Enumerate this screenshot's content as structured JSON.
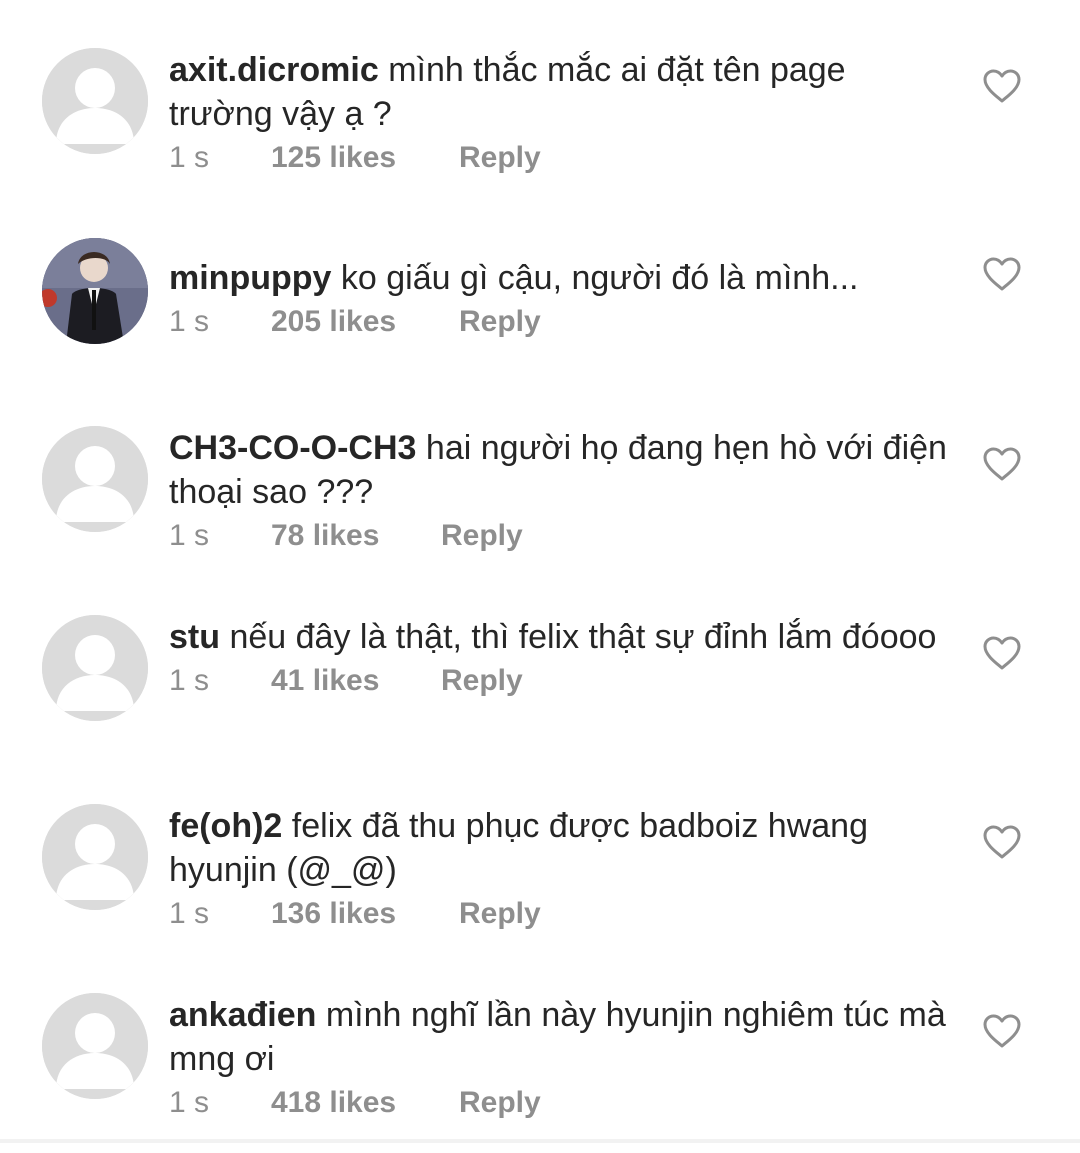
{
  "comments": [
    {
      "username": "axit.dicromic",
      "text": "mình thắc mắc ai đặt tên page trường vậy ạ ?",
      "time": "1 s",
      "likes": "125 likes",
      "reply_label": "Reply",
      "avatar_type": "default-avatar"
    },
    {
      "username": "minpuppy",
      "text": "ko giấu gì cậu, người đó là mình...",
      "time": "1 s",
      "likes": "205 likes",
      "reply_label": "Reply",
      "avatar_type": "photo-avatar"
    },
    {
      "username": "CH3-CO-O-CH3",
      "text": "hai người họ đang hẹn hò với điện thoại sao ???",
      "time": "1 s",
      "likes": "78 likes",
      "reply_label": "Reply",
      "avatar_type": "default-avatar"
    },
    {
      "username": "stu",
      "text": "nếu đây là thật, thì felix thật sự đỉnh lắm đóooo",
      "time": "1 s",
      "likes": "41 likes",
      "reply_label": "Reply",
      "avatar_type": "default-avatar"
    },
    {
      "username": "fe(oh)2",
      "text": "felix đã thu phục được badboiz hwang hyunjin (@_@)",
      "time": "1 s",
      "likes": "136 likes",
      "reply_label": "Reply",
      "avatar_type": "default-avatar"
    },
    {
      "username": "ankađien",
      "text": "mình nghĩ lần này hyunjin nghiêm túc mà mng ơi",
      "time": "1 s",
      "likes": "418 likes",
      "reply_label": "Reply",
      "avatar_type": "default-avatar"
    }
  ],
  "icons": {
    "like": "heart-outline-icon",
    "avatar_placeholder": "user-silhouette-icon"
  },
  "colors": {
    "text": "#262626",
    "meta": "#8e8e8e",
    "avatar_bg": "#dbdbdb",
    "heart": "#8e8e8e"
  }
}
